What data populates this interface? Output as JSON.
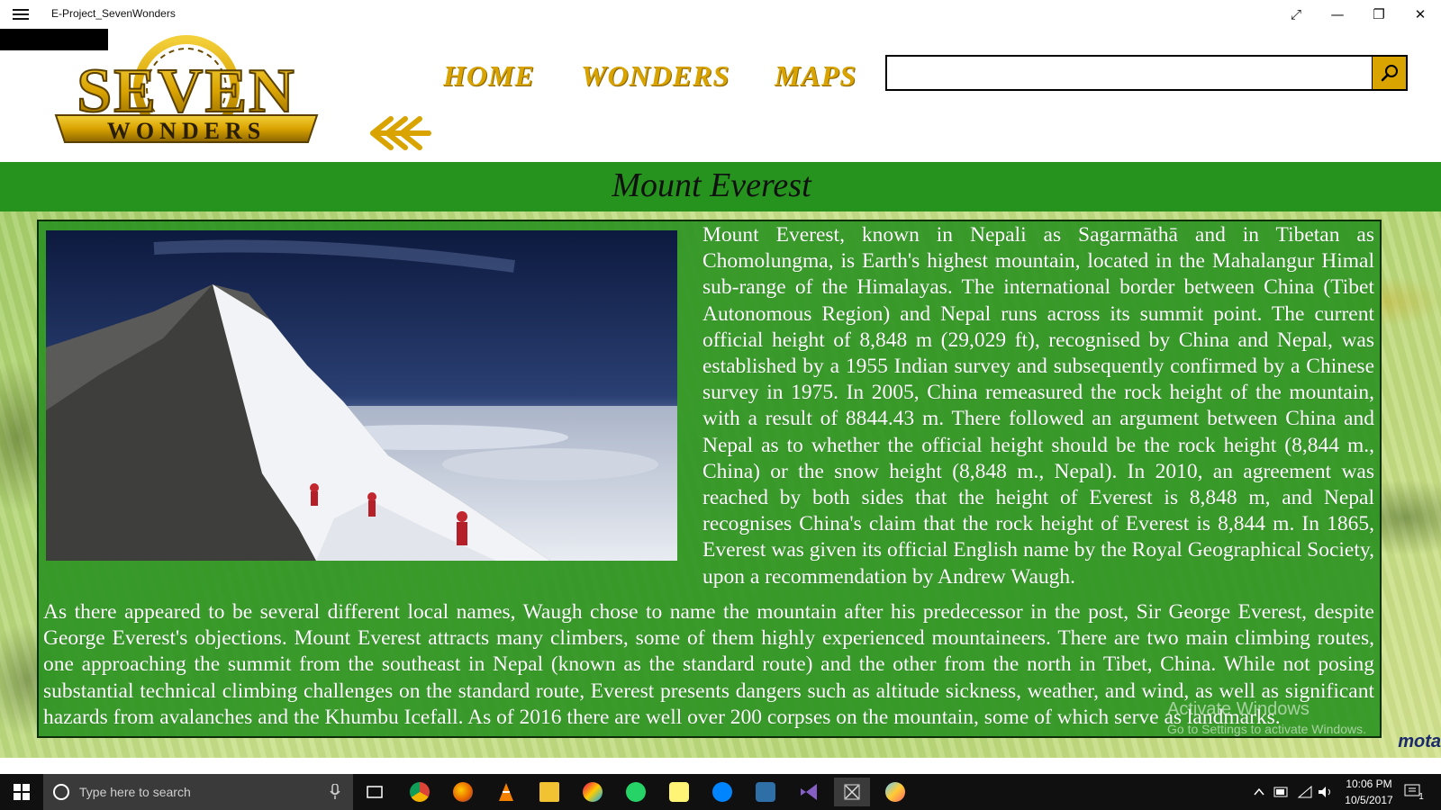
{
  "window": {
    "app_title": "E-Project_SevenWonders",
    "controls": {
      "fullscreen": "⤢",
      "minimize": "—",
      "maximize": "❐",
      "close": "✕"
    }
  },
  "header": {
    "logo": {
      "top": "SEVEN",
      "bottom": "WONDERS"
    },
    "nav": [
      {
        "label": "HOME"
      },
      {
        "label": "WONDERS"
      },
      {
        "label": "MAPS"
      }
    ],
    "search": {
      "value": "",
      "placeholder": ""
    }
  },
  "page": {
    "title": "Mount Everest",
    "paragraph_right": "Mount Everest, known in Nepali as Sagarmāthā and in Tibetan as Chomolungma, is Earth's highest mountain, located in the Mahalangur Himal sub-range of the Himalayas. The international border between China (Tibet Autonomous Region) and Nepal runs across its summit point. The current official height of 8,848 m (29,029 ft), recognised by China and Nepal, was established by a 1955 Indian survey and subsequently confirmed by a Chinese survey in 1975. In 2005, China remeasured the rock height of the mountain, with a result of 8844.43 m. There followed an argument between China and Nepal as to whether the official height should be the rock height (8,844 m., China) or the snow height (8,848 m., Nepal). In 2010, an agreement was reached by both sides that the height of Everest is 8,848 m, and Nepal recognises China's claim that the rock height of Everest is 8,844 m. In 1865, Everest was given its official English name by the Royal Geographical Society, upon a recommendation by Andrew Waugh.",
    "paragraph_bottom": " As there appeared to be several different local names, Waugh chose to name the mountain after his predecessor in the post, Sir George Everest, despite George Everest's objections. Mount Everest attracts many climbers, some of them highly experienced mountaineers. There are two main climbing routes, one approaching the summit from the southeast in Nepal (known as the standard route) and the other from the north in Tibet, China. While not posing substantial technical climbing challenges on the standard route, Everest presents dangers such as altitude sickness, weather, and wind, as well as significant hazards from avalanches and the Khumbu Icefall. As of 2016 there are well over 200 corpses on the mountain, some of which serve as landmarks."
  },
  "watermark": {
    "line1": "Activate Windows",
    "line2": "Go to Settings to activate Windows."
  },
  "corner_logo": "mota",
  "taskbar": {
    "search_placeholder": "Type here to search",
    "apps": [
      "chrome-icon",
      "firefox-icon",
      "vlc-icon",
      "file-explorer-icon",
      "paint-icon",
      "whatsapp-icon",
      "sticky-notes-icon",
      "messenger-icon",
      "task-app-icon",
      "visual-studio-icon",
      "seven-wonders-app-icon",
      "paint-palette-icon"
    ],
    "clock_time": "10:06 PM",
    "clock_date": "10/5/2017",
    "notification_count": "1"
  },
  "colors": {
    "accent_gold": "#d9a300",
    "band_green": "#26931e",
    "panel_green": "#26911e",
    "taskbar": "#101010"
  }
}
